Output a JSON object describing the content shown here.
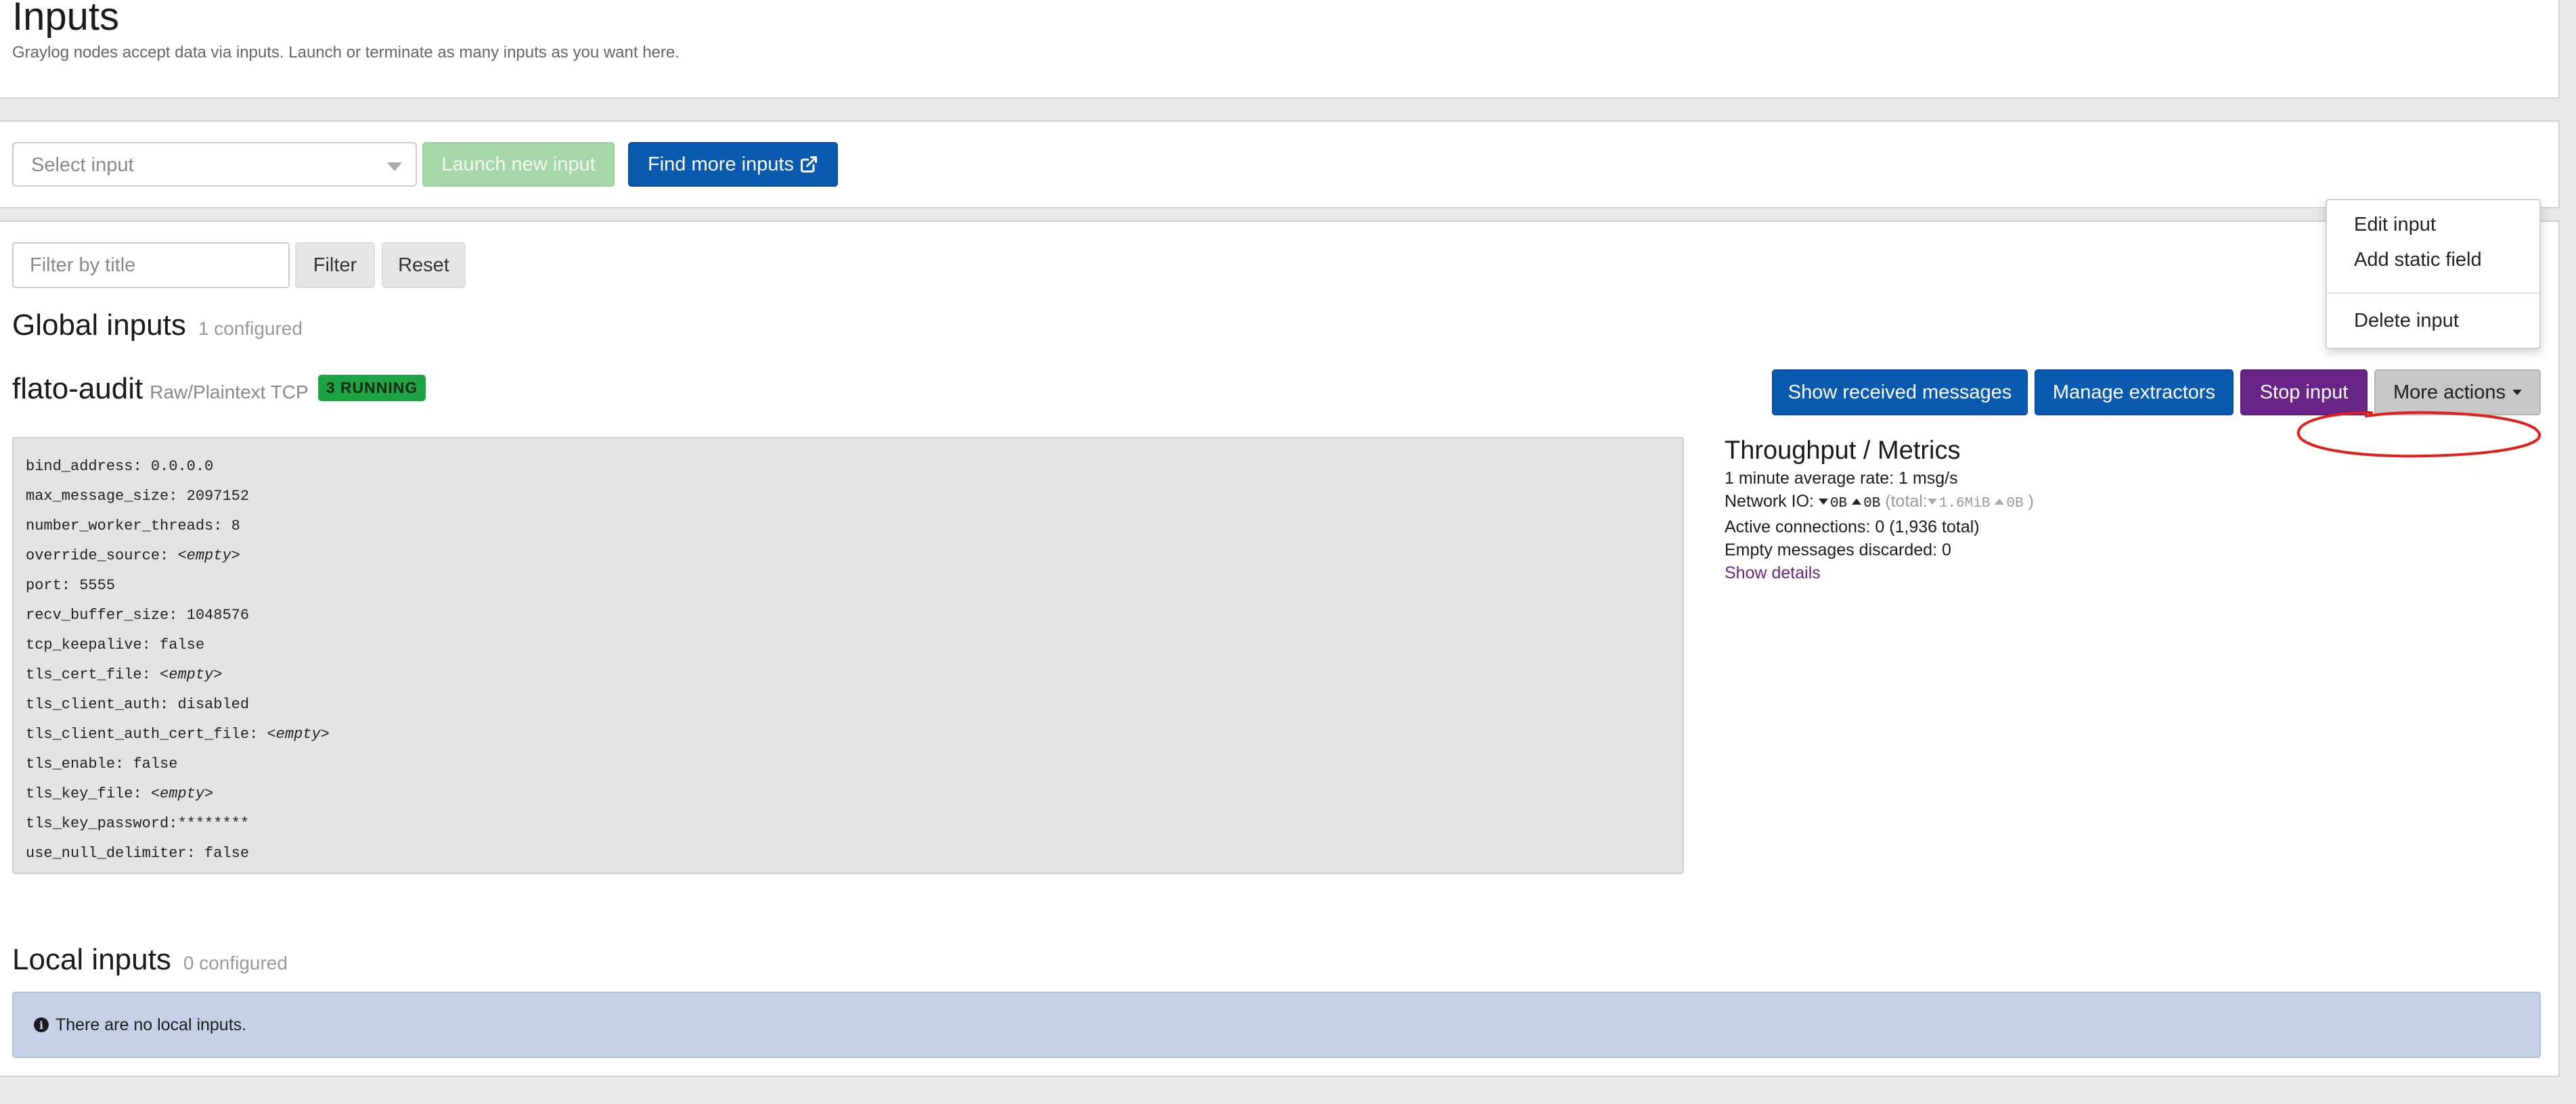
{
  "header": {
    "title": "Inputs",
    "description": "Graylog nodes accept data via inputs. Launch or terminate as many inputs as you want here."
  },
  "launch": {
    "select_placeholder": "Select input",
    "launch_label": "Launch new input",
    "find_label": "Find more inputs"
  },
  "filter": {
    "placeholder": "Filter by title",
    "filter_label": "Filter",
    "reset_label": "Reset"
  },
  "global": {
    "title": "Global inputs",
    "count": "1 configured"
  },
  "input": {
    "name": "flato-audit",
    "type": "Raw/Plaintext TCP",
    "badge": "3 RUNNING",
    "actions": {
      "show_messages": "Show received messages",
      "manage_extractors": "Manage extractors",
      "stop": "Stop input",
      "more": "More actions"
    },
    "config": [
      {
        "key": "bind_address",
        "value": "0.0.0.0"
      },
      {
        "key": "max_message_size",
        "value": "2097152"
      },
      {
        "key": "number_worker_threads",
        "value": "8"
      },
      {
        "key": "override_source",
        "value": "<empty>"
      },
      {
        "key": "port",
        "value": "5555"
      },
      {
        "key": "recv_buffer_size",
        "value": "1048576"
      },
      {
        "key": "tcp_keepalive",
        "value": "false"
      },
      {
        "key": "tls_cert_file",
        "value": "<empty>"
      },
      {
        "key": "tls_client_auth",
        "value": "disabled"
      },
      {
        "key": "tls_client_auth_cert_file",
        "value": "<empty>"
      },
      {
        "key": "tls_enable",
        "value": "false"
      },
      {
        "key": "tls_key_file",
        "value": "<empty>"
      },
      {
        "key": "tls_key_password",
        "value": "********"
      },
      {
        "key": "use_null_delimiter",
        "value": "false"
      }
    ],
    "metrics": {
      "title": "Throughput / Metrics",
      "avg_rate": "1 minute average rate: 1 msg/s",
      "network_label": "Network IO:",
      "net_in": "0B",
      "net_out": "0B",
      "total_label": "(total:",
      "total_in": "1.6MiB",
      "total_out": "0B",
      "total_close": ")",
      "connections": "Active connections: 0 (1,936 total)",
      "discarded": "Empty messages discarded: 0",
      "details_link": "Show details"
    },
    "menu": {
      "edit": "Edit input",
      "add_static": "Add static field",
      "delete": "Delete input"
    }
  },
  "local": {
    "title": "Local inputs",
    "count": "0 configured",
    "empty_message": "There are no local inputs."
  },
  "colors": {
    "primary": "#0a5aaf",
    "success": "#1fa443",
    "purple": "#6a2387",
    "info_bg": "#c6d1e8",
    "annotation": "#e0201c"
  }
}
